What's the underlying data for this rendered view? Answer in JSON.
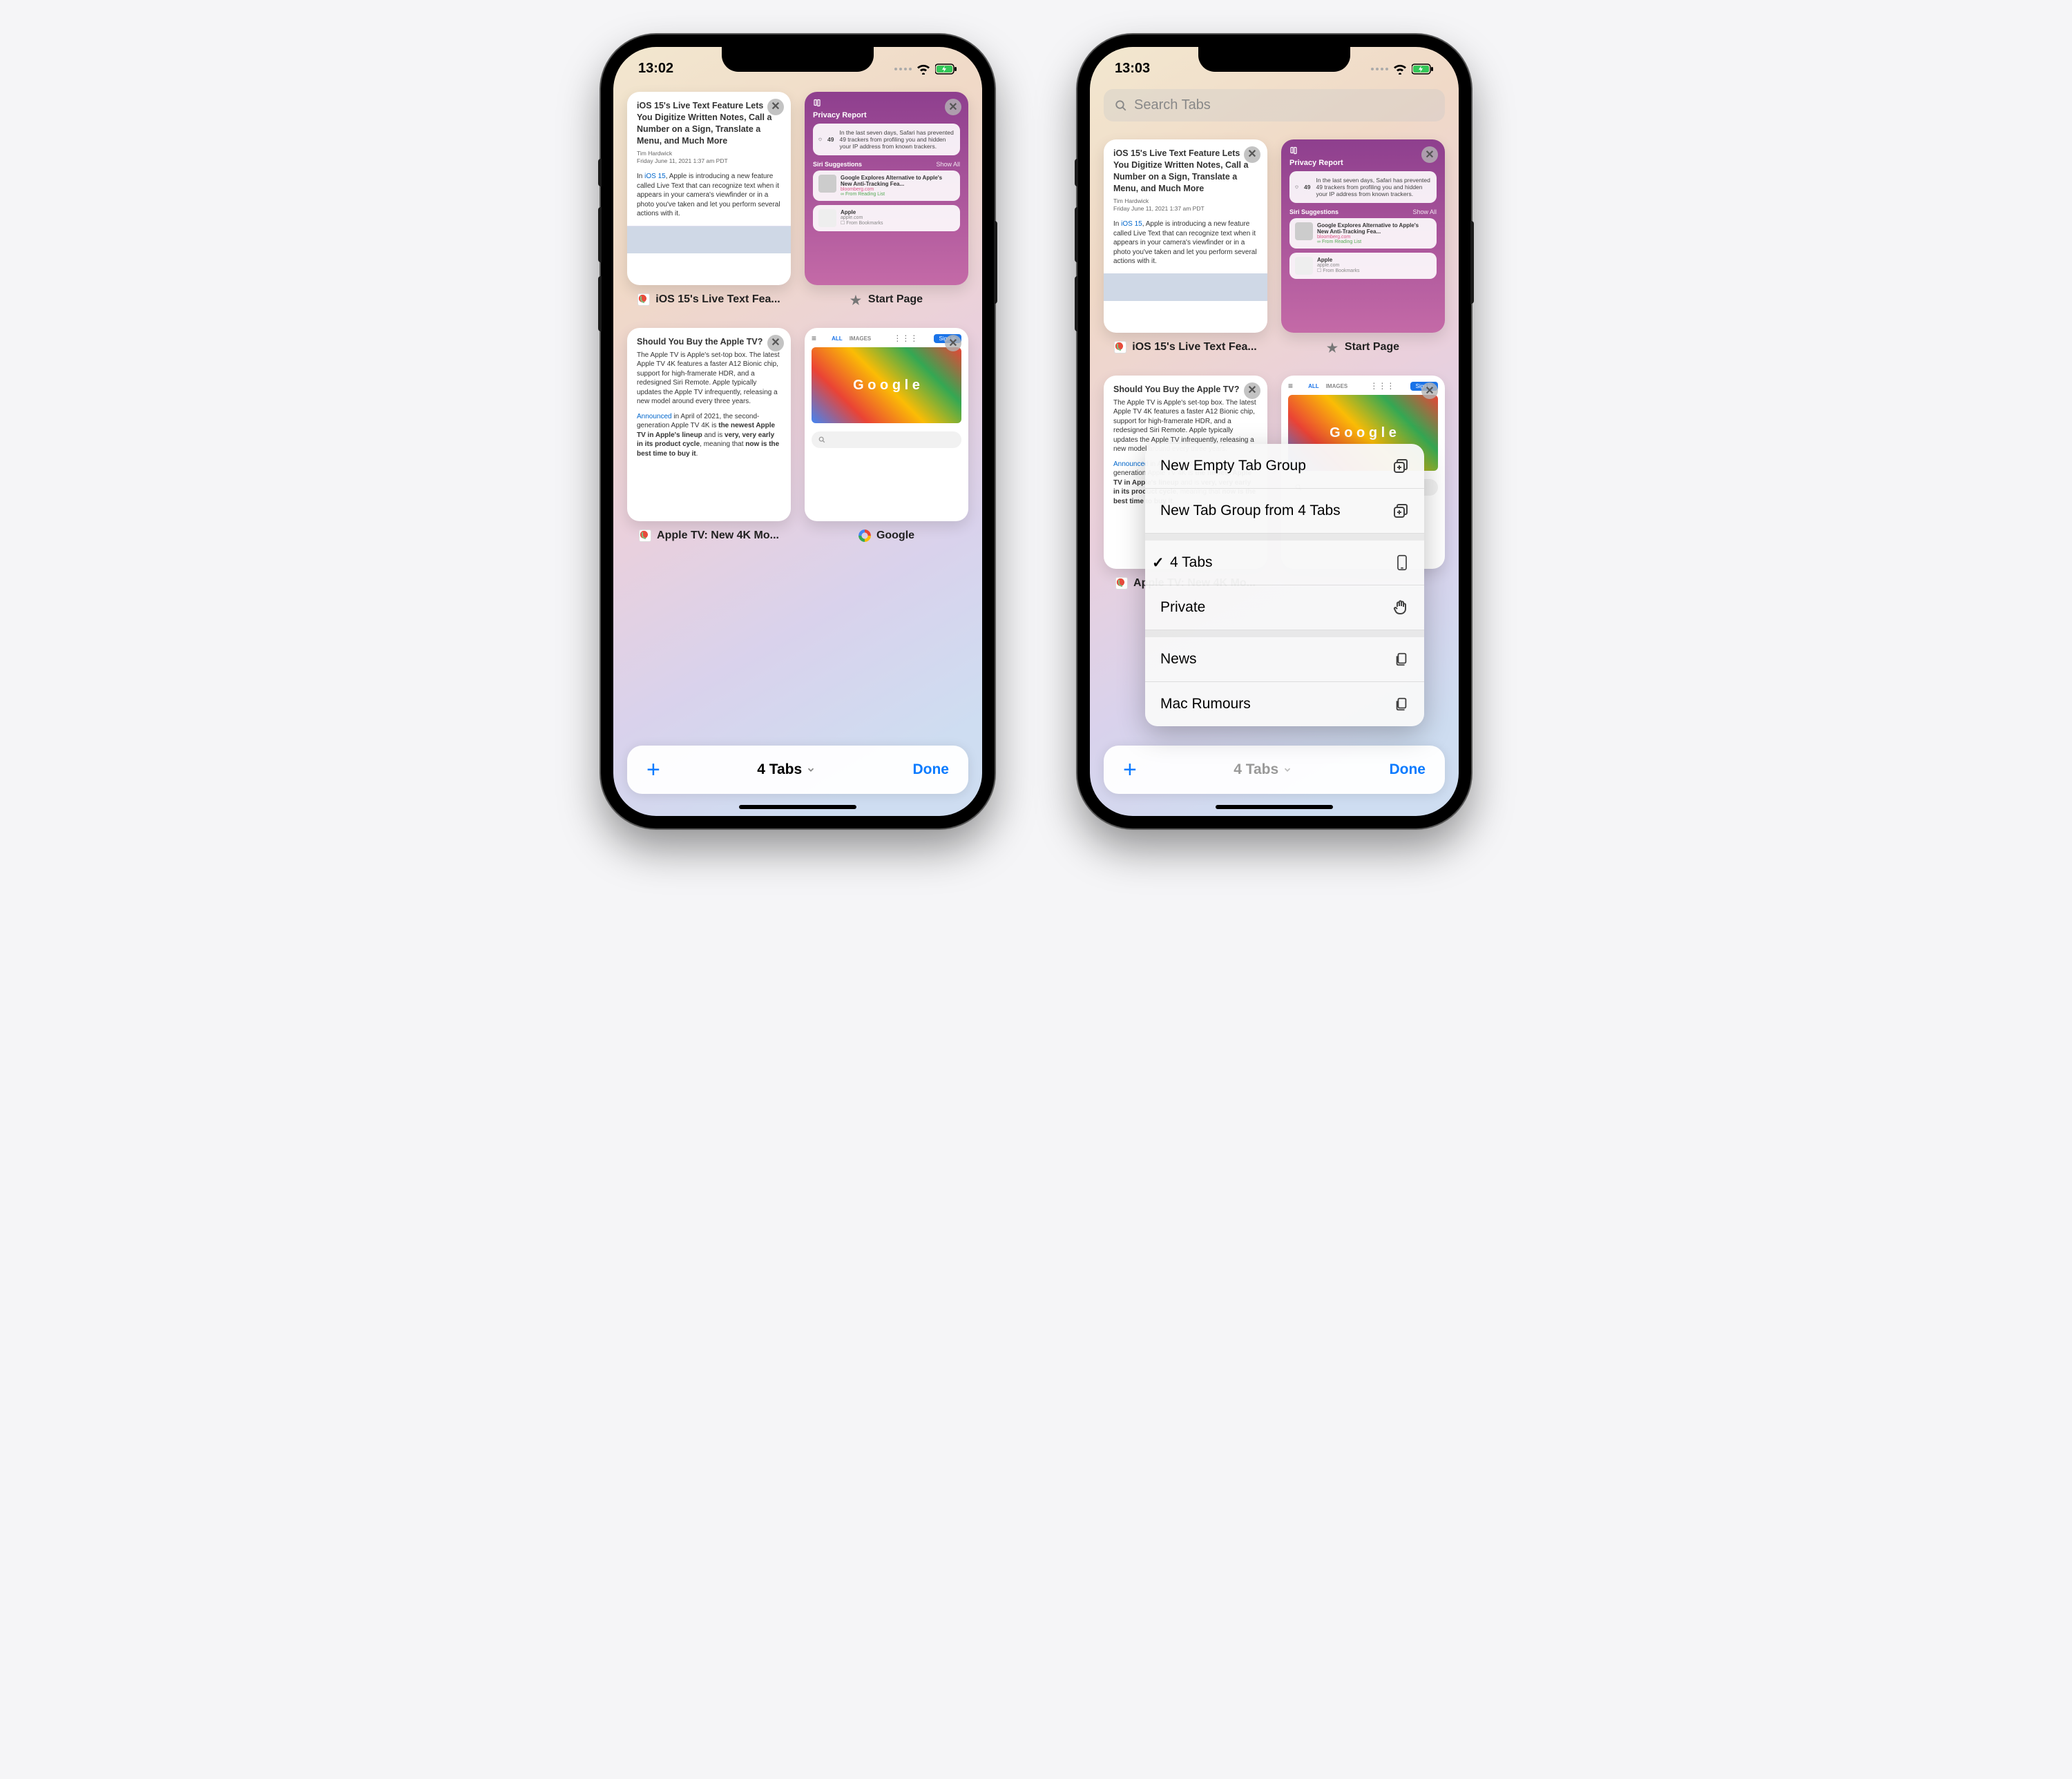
{
  "left": {
    "status": {
      "time": "13:02"
    },
    "tabs": [
      {
        "key": "ios15",
        "headline": "iOS 15's Live Text Feature Lets You Digitize Written Notes, Call a Number on a Sign, Translate a Menu, and Much More",
        "author": "Tim Hardwick",
        "date": "Friday June 11, 2021 1:37 am PDT",
        "body_pre": "In ",
        "body_link": "iOS 15",
        "body_post": ", Apple is introducing a new feature called Live Text that can recognize text when it appears in your camera's viewfinder or in a photo you've taken and let you perform several actions with it.",
        "label": "iOS 15's Live Text Fea..."
      },
      {
        "key": "startpage",
        "privacy_title": "Privacy Report",
        "privacy_count": "49",
        "privacy_text": "In the last seven days, Safari has prevented 49 trackers from profiling you and hidden your IP address from known trackers.",
        "siri_title": "Siri Suggestions",
        "siri_show_all": "Show All",
        "sugg1_title": "Google Explores Alternative to Apple's New Anti-Tracking Fea...",
        "sugg1_src": "bloomberg.com",
        "sugg1_tag": "From Reading List",
        "sugg2_title": "Apple",
        "sugg2_src": "apple.com",
        "sugg2_tag": "From Bookmarks",
        "label": "Start Page"
      },
      {
        "key": "atv",
        "headline": "Should You Buy the Apple TV?",
        "body1": "The Apple TV is Apple's set-top box. The latest Apple TV 4K features a faster A12 Bionic chip, support for high-framerate HDR, and a redesigned Siri Remote. Apple typically updates the Apple TV infrequently, releasing a new model around every three years.",
        "body2_link": "Announced",
        "body2_a": " in April of 2021, the second-generation Apple TV 4K is ",
        "body2_b1": "the newest Apple TV in Apple's lineup",
        "body2_c": " and is ",
        "body2_b2": "very, very early in its product cycle",
        "body2_d": ", meaning that ",
        "body2_b3": "now is the best time to buy it",
        "body2_e": ".",
        "label": "Apple TV: New 4K Mo..."
      },
      {
        "key": "google",
        "tab_all": "ALL",
        "tab_images": "IMAGES",
        "signin": "Sign in",
        "label": "Google"
      }
    ],
    "bottombar": {
      "group": "4 Tabs",
      "done": "Done"
    }
  },
  "right": {
    "status": {
      "time": "13:03"
    },
    "search_placeholder": "Search Tabs",
    "bottombar": {
      "group": "4 Tabs",
      "done": "Done"
    },
    "popup": {
      "new_empty": "New Empty Tab Group",
      "new_from": "New Tab Group from 4 Tabs",
      "selected": "4 Tabs",
      "private": "Private",
      "group_news": "News",
      "group_mac": "Mac Rumours"
    }
  }
}
